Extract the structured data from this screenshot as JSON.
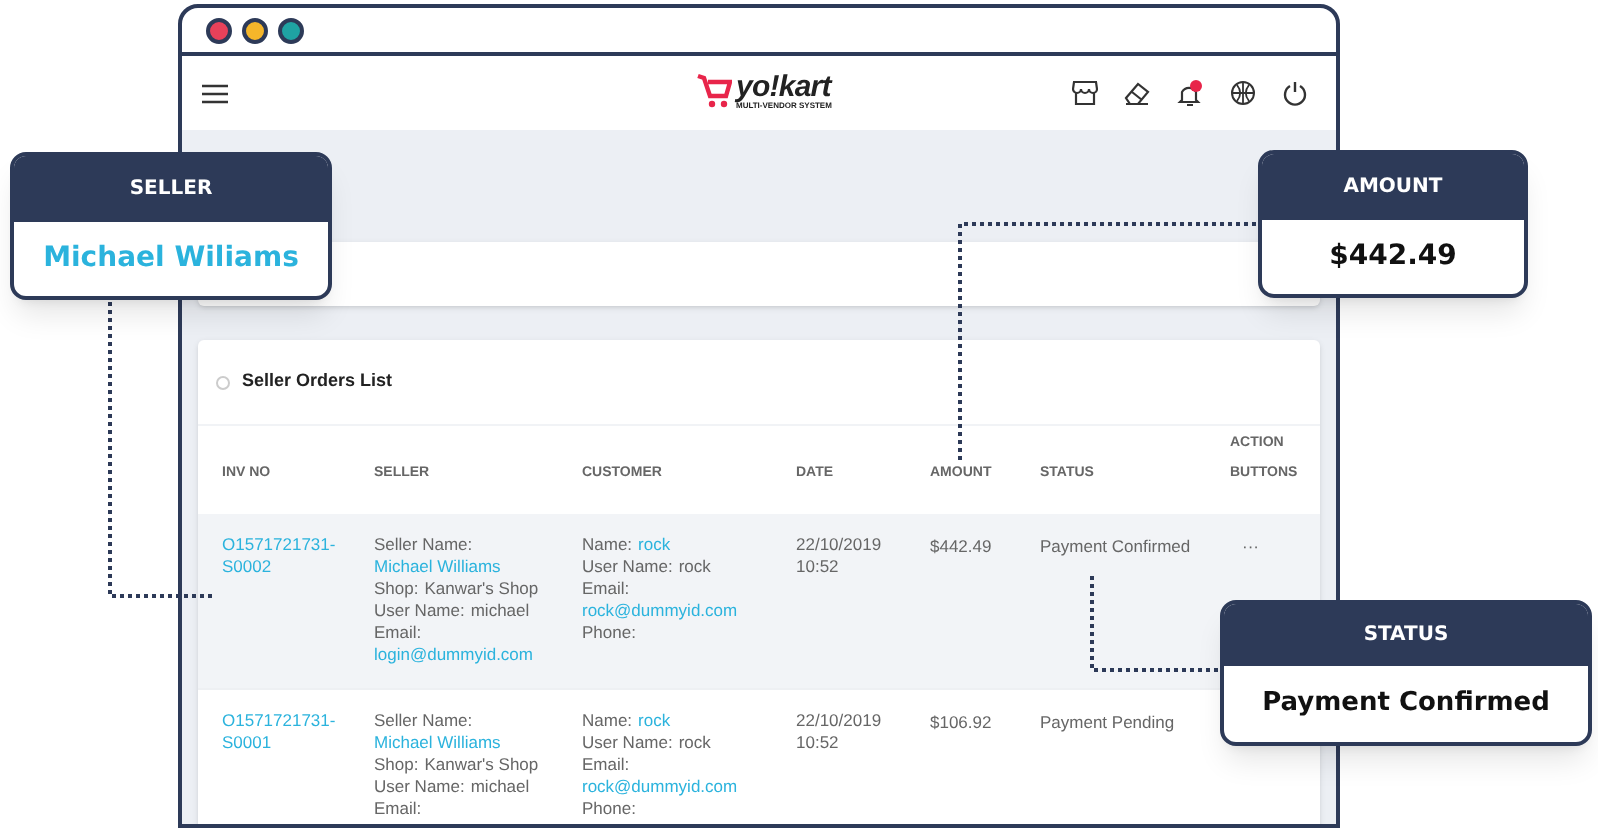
{
  "window": {
    "buttons": [
      {
        "color": "#e8415a"
      },
      {
        "color": "#f5b62a"
      },
      {
        "color": "#1fa3a3"
      }
    ]
  },
  "header": {
    "logo": {
      "name": "yo!kart",
      "tagline": "MULTI-VENDOR SYSTEM"
    }
  },
  "card": {
    "title": "Seller Orders List"
  },
  "table": {
    "columns": [
      "INV NO",
      "SELLER",
      "CUSTOMER",
      "DATE",
      "AMOUNT",
      "STATUS",
      "ACTION BUTTONS"
    ],
    "rows": [
      {
        "hovered": true,
        "inv_no": "O1571721731-S0002",
        "seller": [
          {
            "label": "Seller Name:",
            "value": "Michael Williams",
            "link": true
          },
          {
            "label": "Shop:",
            "value": "Kanwar's Shop",
            "link": false
          },
          {
            "label": "User Name:",
            "value": "michael",
            "link": false
          },
          {
            "label": "Email:",
            "value": "login@dummyid.com",
            "link": true
          }
        ],
        "customer": [
          {
            "label": "Name:",
            "value": "rock",
            "link": true
          },
          {
            "label": "User Name:",
            "value": "rock",
            "link": false
          },
          {
            "label": "Email:",
            "value": "rock@dummyid.com",
            "link": true
          },
          {
            "label": "Phone:"
          }
        ],
        "date": "22/10/2019 10:52",
        "amount": "$442.49",
        "status": "Payment Confirmed",
        "actions": "···"
      },
      {
        "hovered": false,
        "inv_no": "O1571721731-S0001",
        "seller": [
          {
            "label": "Seller Name:",
            "value": "Michael Williams",
            "link": true
          },
          {
            "label": "Shop:",
            "value": "Kanwar's Shop",
            "link": false
          },
          {
            "label": "User Name:",
            "value": "michael",
            "link": false
          },
          {
            "label": "Email:"
          }
        ],
        "customer": [
          {
            "label": "Name:",
            "value": "rock",
            "link": true
          },
          {
            "label": "User Name:",
            "value": "rock",
            "link": false
          },
          {
            "label": "Email:",
            "value": "rock@dummyid.com",
            "link": true
          },
          {
            "label": "Phone:"
          }
        ],
        "date": "22/10/2019 10:52",
        "amount": "$106.92",
        "status": "Payment Pending"
      }
    ]
  },
  "callouts": [
    {
      "kind": "seller",
      "title": "SELLER",
      "value": "Michael Wiliams"
    },
    {
      "kind": "amount",
      "title": "AMOUNT",
      "value": "$442.49"
    },
    {
      "kind": "status",
      "title": "STATUS",
      "value": "Payment Confirmed"
    }
  ]
}
